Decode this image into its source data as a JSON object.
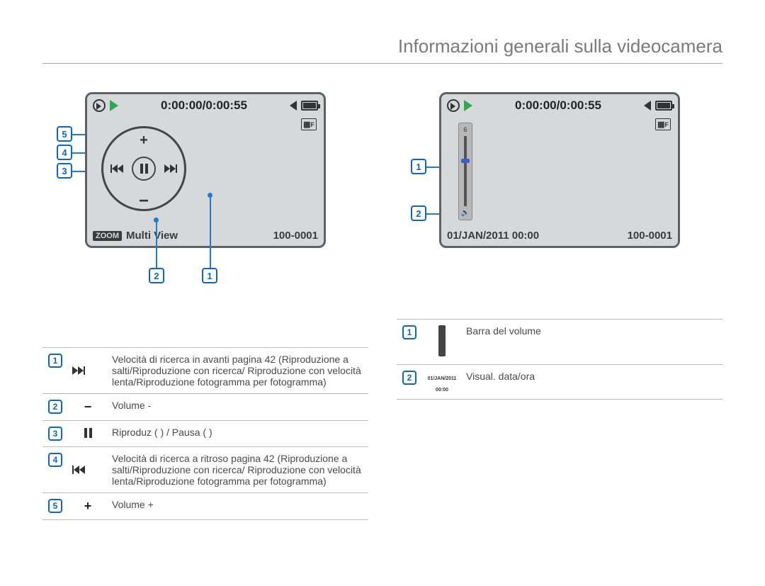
{
  "page_title": "Informazioni generali sulla videocamera",
  "screen1": {
    "timecode": "0:00:00/0:00:55",
    "quality_badge": "F",
    "zoom_label": "ZOOM",
    "multiview_label": "Multi View",
    "file_number": "100-0001"
  },
  "screen2": {
    "timecode": "0:00:00/0:00:55",
    "quality_badge": "F",
    "date_time": "01/JAN/2011 00:00",
    "file_number": "100-0001",
    "volume_value": "6"
  },
  "callouts_left": [
    "5",
    "4",
    "3",
    "2",
    "1"
  ],
  "callouts_right": [
    "1",
    "2"
  ],
  "legend_left": [
    {
      "n": "1",
      "icon_type": "ff",
      "text": "Velocità di ricerca in avanti pagina 42 (Riproduzione a salti/Riproduzione con ricerca/ Riproduzione con velocità lenta/Riproduzione fotogramma per fotogramma)"
    },
    {
      "n": "2",
      "icon_type": "minus",
      "text": "Volume -"
    },
    {
      "n": "3",
      "icon_type": "pause",
      "text": "Riproduz ( ) / Pausa ( )"
    },
    {
      "n": "4",
      "icon_type": "rw",
      "text": "Velocità di ricerca a ritroso pagina 42 (Riproduzione a salti/Riproduzione con ricerca/ Riproduzione con velocità lenta/Riproduzione fotogramma per fotogramma)"
    },
    {
      "n": "5",
      "icon_type": "plus",
      "text": "Volume +"
    }
  ],
  "legend_right": [
    {
      "n": "1",
      "icon_type": "volbar",
      "text": "Barra del volume"
    },
    {
      "n": "2",
      "icon_type": "date",
      "text": "Visual. data/ora"
    }
  ],
  "mini_date_label": "01/JAN/2011 00:00"
}
